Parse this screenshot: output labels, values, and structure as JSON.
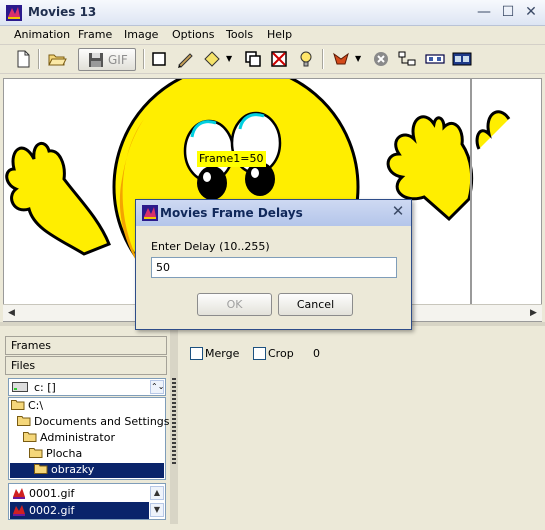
{
  "window": {
    "title": "Movies 13"
  },
  "menu": [
    {
      "label": "Animation",
      "u": "A"
    },
    {
      "label": "Frame",
      "u": "F"
    },
    {
      "label": "Image",
      "u": "I"
    },
    {
      "label": "Options",
      "u": "O"
    },
    {
      "label": "Tools",
      "u": "T"
    },
    {
      "label": "Help",
      "u": "H"
    }
  ],
  "toolbar": {
    "gif_label": "GIF"
  },
  "canvas": {
    "frame_label": "Frame1=50"
  },
  "left_panel": {
    "frames_tab": "Frames",
    "files_tab": "Files",
    "drive": "c: []",
    "tree": [
      {
        "label": "C:\\",
        "indent": 0
      },
      {
        "label": "Documents and Settings",
        "indent": 1
      },
      {
        "label": "Administrator",
        "indent": 2
      },
      {
        "label": "Plocha",
        "indent": 3
      },
      {
        "label": "obrazky",
        "indent": 4,
        "selected": true
      }
    ],
    "files": [
      {
        "name": "0001.gif",
        "selected": false
      },
      {
        "name": "0002.gif",
        "selected": true
      }
    ]
  },
  "right_panel": {
    "merge_label": "Merge",
    "crop_label": "Crop",
    "count": "0"
  },
  "dialog": {
    "title": "Movies Frame Delays",
    "prompt": "Enter Delay (10..255)",
    "value": "50",
    "ok_label": "OK",
    "cancel_label": "Cancel"
  },
  "colors": {
    "selection": "#0a246a",
    "smiley_yellow": "#ffee00",
    "label_bg": "#ffff00"
  }
}
